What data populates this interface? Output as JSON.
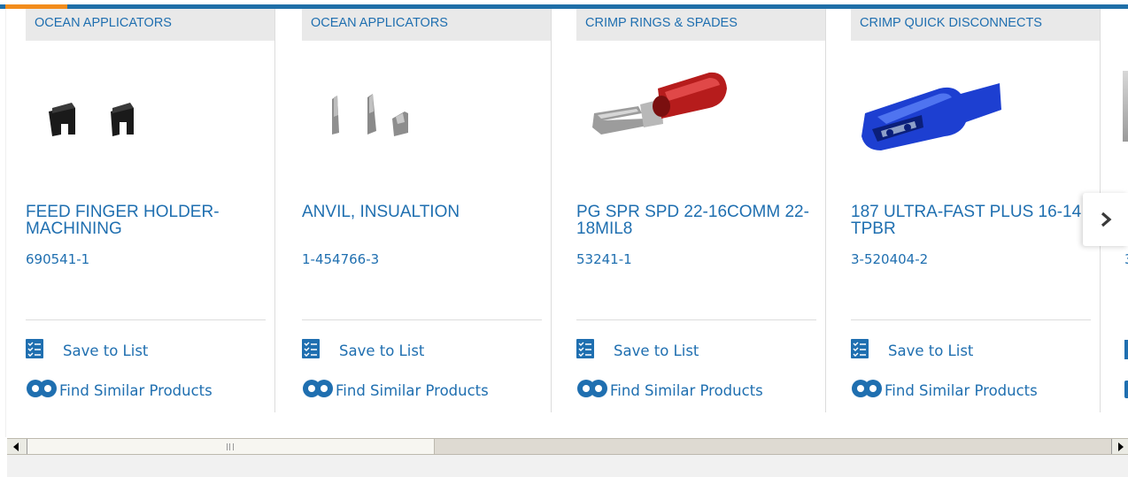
{
  "products": [
    {
      "category": "OCEAN APPLICATORS",
      "title": "FEED FINGER HOLDER-MACHINING",
      "part_number": "690541-1",
      "save_label": "Save to List",
      "similar_label": "Find Similar Products"
    },
    {
      "category": "OCEAN APPLICATORS",
      "title": "ANVIL, INSUALTION",
      "part_number": "1-454766-3",
      "save_label": "Save to List",
      "similar_label": "Find Similar Products"
    },
    {
      "category": "CRIMP RINGS & SPADES",
      "title": "PG SPR SPD 22-16COMM 22-18MIL8",
      "part_number": "53241-1",
      "save_label": "Save to List",
      "similar_label": "Find Similar Products"
    },
    {
      "category": "CRIMP QUICK DISCONNECTS",
      "title": "187 ULTRA-FAST PLUS 16-14 TPBR",
      "part_number": "3-520404-2",
      "save_label": "Save to List",
      "similar_label": "Find Similar Products"
    }
  ],
  "partial_card": {
    "part_number_fragment": "3"
  },
  "carousel": {
    "next_icon": "chevron-right-icon"
  },
  "colors": {
    "link_blue": "#1f6fb0",
    "accent_orange": "#f28c1c",
    "header_blue": "#1f6fa8",
    "category_bg": "#e9e9e9"
  }
}
